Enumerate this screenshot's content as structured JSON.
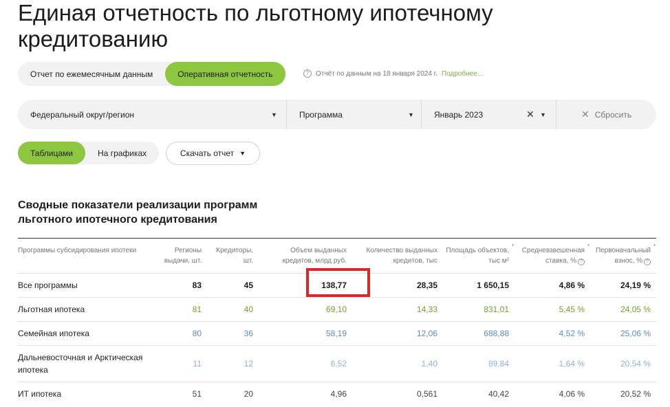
{
  "page": {
    "title": "Единая отчетность по льготному ипотечному кредитованию"
  },
  "mode_toggle": {
    "monthly_label": "Отчет по ежемесячным данным",
    "operational_label": "Оперативная отчетность"
  },
  "report_note": {
    "text": "Отчёт по данным на 18 января 2024 г.",
    "more_link": "Подробнее..."
  },
  "filters": {
    "region": "Федеральный округ/регион",
    "program": "Программа",
    "month": "Январь 2023",
    "reset_label": "Сбросить"
  },
  "view_toggle": {
    "tables_label": "Таблицами",
    "charts_label": "На графиках"
  },
  "download": {
    "label": "Скачать отчет"
  },
  "section": {
    "title": "Сводные показатели реализации программ льготного ипотечного кредитования"
  },
  "table": {
    "headers": [
      "Программы субсидирования ипотеки",
      "Регионы выдачи, шт.",
      "Кредиторы, шт.",
      "Объем выданных кредитов, млрд руб.",
      "Количество выданных кредитов, тыс",
      "Площадь объектов, тыс м²",
      "Средневзвешенная ставка, %",
      "Первоначальный взнос, %"
    ],
    "rows": [
      [
        "Все программы",
        "83",
        "45",
        "138,77",
        "28,35",
        "1 650,15",
        "4,86 %",
        "24,19 %"
      ],
      [
        "Льготная ипотека",
        "81",
        "40",
        "69,10",
        "14,33",
        "831,01",
        "5,45 %",
        "24,05 %"
      ],
      [
        "Семейная ипотека",
        "80",
        "36",
        "58,19",
        "12,06",
        "688,88",
        "4,52 %",
        "25,06 %"
      ],
      [
        "Дальневосточная и Арктическая ипотека",
        "11",
        "12",
        "6,52",
        "1,40",
        "89,84",
        "1,64 %",
        "20,54 %"
      ],
      [
        "ИТ ипотека",
        "51",
        "20",
        "4,96",
        "0,561",
        "40,42",
        "4,06 %",
        "20,52 %"
      ]
    ]
  },
  "colors": {
    "accent_green": "#8dc63f",
    "highlight_red": "#e0242b",
    "row_green": "#6fa32e",
    "row_blue": "#5b8ac8",
    "row_lightblue": "#8fb0dd"
  }
}
